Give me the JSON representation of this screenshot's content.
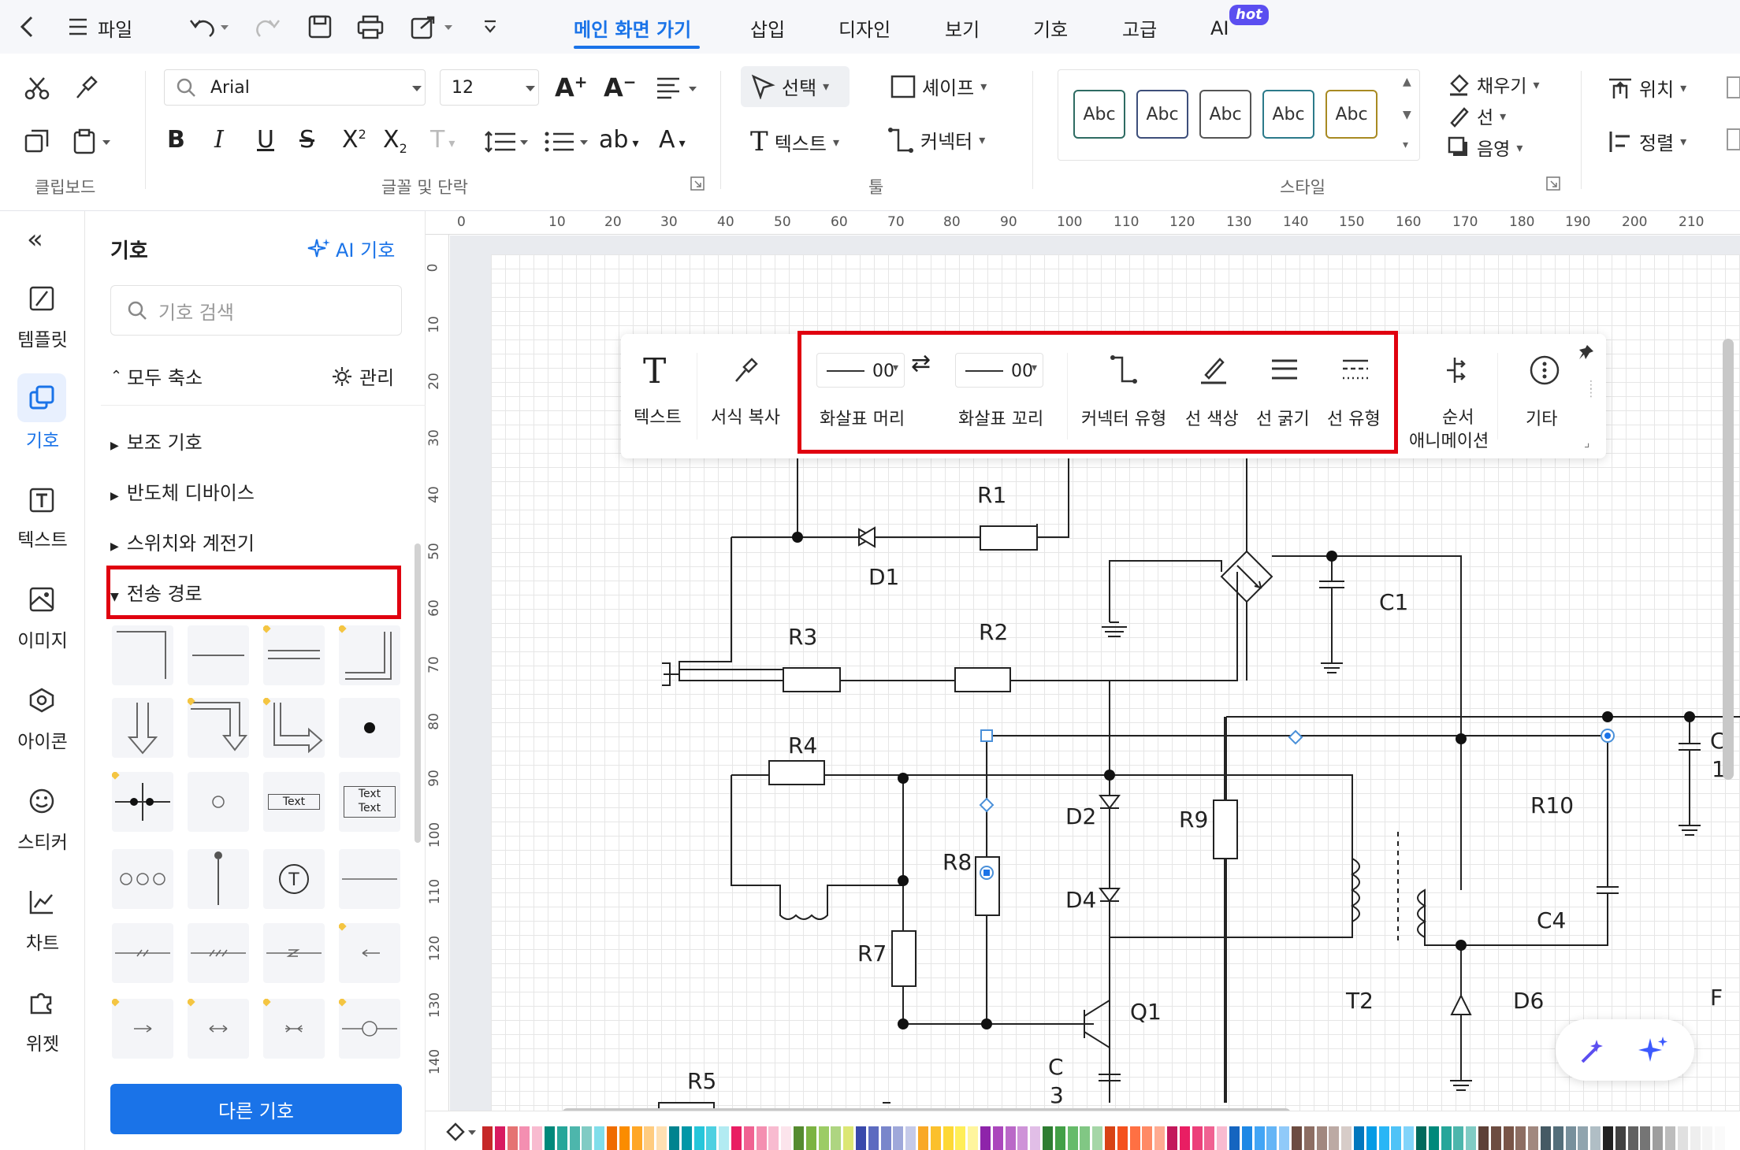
{
  "tabbar": {
    "file": "파일",
    "tabs": [
      "메인 화면 가기",
      "삽입",
      "디자인",
      "보기",
      "기호",
      "고급",
      "AI"
    ],
    "hot_badge": "hot"
  },
  "ribbon": {
    "font_name": "Arial",
    "font_size": "12",
    "select": "선택",
    "shape": "셰이프",
    "text": "텍스트",
    "connector": "커넥터",
    "style_samples": [
      "Abc",
      "Abc",
      "Abc",
      "Abc",
      "Abc"
    ],
    "fill": "채우기",
    "line": "선",
    "shadow": "음영",
    "position": "위치",
    "align": "정렬",
    "group_clipboard": "클립보드",
    "group_font": "글꼴 및 단락",
    "group_tools": "툴",
    "group_style": "스타일"
  },
  "leftbar": [
    "템플릿",
    "기호",
    "텍스트",
    "이미지",
    "아이콘",
    "스티커",
    "차트",
    "위젯"
  ],
  "panel": {
    "title": "기호",
    "ai_symbol": "AI 기호",
    "search_placeholder": "기호 검색",
    "collapse_all": "모두 축소",
    "manage": "관리",
    "categories": [
      "보조 기호",
      "반도체 디바이스",
      "스위치와 계전기",
      "전송 경로"
    ],
    "sym_text_1": "Text",
    "sym_text_2a": "Text",
    "sym_text_2b": "Text",
    "more_symbols": "다른 기호"
  },
  "ruler": {
    "h": [
      "0",
      "10",
      "20",
      "30",
      "40",
      "50",
      "60",
      "70",
      "80",
      "90",
      "100",
      "110",
      "120",
      "130",
      "140",
      "150",
      "160",
      "170",
      "180",
      "190",
      "200",
      "210"
    ],
    "v": [
      "0",
      "10",
      "20",
      "30",
      "40",
      "50",
      "60",
      "70",
      "80",
      "90",
      "100",
      "110",
      "120",
      "130",
      "140"
    ]
  },
  "floating_toolbar": {
    "text": "텍스트",
    "format_painter": "서식 복사",
    "arrow_head_value": "00",
    "arrow_head": "화살표 머리",
    "arrow_tail_value": "00",
    "arrow_tail": "화살표 꼬리",
    "connector_type": "커넥터 유형",
    "line_color": "선 색상",
    "line_width": "선 굵기",
    "line_type": "선 유형",
    "seq_anim_1": "순서",
    "seq_anim_2": "애니메이션",
    "more": "기타"
  },
  "circuit_labels": {
    "R1": "R1",
    "D1": "D1",
    "C1": "C1",
    "R3": "R3",
    "R2": "R2",
    "R4": "R4",
    "R8": "R8",
    "D2": "D2",
    "D4": "D4",
    "R9": "R9",
    "R10": "R10",
    "C4": "C4",
    "R7": "R7",
    "Q1": "Q1",
    "T2": "T2",
    "D6": "D6",
    "C3a": "C",
    "C3b": "3",
    "R5": "R5",
    "Cedge": "C",
    "Cedge2": "1",
    "Fedge": "F"
  },
  "palette": [
    "#c62828",
    "#d81b60",
    "#e57373",
    "#f48fb1",
    "#f8bbd0",
    "#00897b",
    "#26a69a",
    "#4db6ac",
    "#80cbc4",
    "#80deea",
    "#ef6c00",
    "#fb8c00",
    "#ffa726",
    "#ffcc80",
    "#ffe0b2",
    "#00838f",
    "#0097a7",
    "#26c6da",
    "#4dd0e1",
    "#b2ebf2",
    "#e91e63",
    "#f06292",
    "#f48fb1",
    "#f8bbd0",
    "#fce4ec",
    "#558b2f",
    "#7cb342",
    "#9ccc65",
    "#aed581",
    "#dce775",
    "#3949ab",
    "#5c6bc0",
    "#7986cb",
    "#9fa8da",
    "#c5cae9",
    "#f9a825",
    "#fbc02d",
    "#fdd835",
    "#ffee58",
    "#fff59d",
    "#8e24aa",
    "#ab47bc",
    "#ba68c8",
    "#ce93d8",
    "#e1bee7",
    "#2e7d32",
    "#43a047",
    "#66bb6a",
    "#81c784",
    "#a5d6a7",
    "#d84315",
    "#f4511e",
    "#ff7043",
    "#ff8a65",
    "#ffab91",
    "#c2185b",
    "#e91e63",
    "#ec407a",
    "#f06292",
    "#f8bbd0",
    "#1565c0",
    "#1e88e5",
    "#42a5f5",
    "#64b5f6",
    "#90caf9",
    "#6d4c41",
    "#8d6e63",
    "#a1887f",
    "#bcaaa4",
    "#d7ccc8",
    "#0277bd",
    "#039be5",
    "#29b6f6",
    "#4fc3f7",
    "#81d4fa",
    "#00695c",
    "#00897b",
    "#26a69a",
    "#4db6ac",
    "#80cbc4",
    "#5d4037",
    "#6d4c41",
    "#795548",
    "#8d6e63",
    "#a1887f",
    "#455a64",
    "#546e7a",
    "#78909c",
    "#90a4ae",
    "#b0bec5",
    "#212121",
    "#424242",
    "#616161",
    "#757575",
    "#9e9e9e",
    "#bdbdbd",
    "#e0e0e0",
    "#eeeeee",
    "#f5f5f5",
    "#fafafa"
  ]
}
